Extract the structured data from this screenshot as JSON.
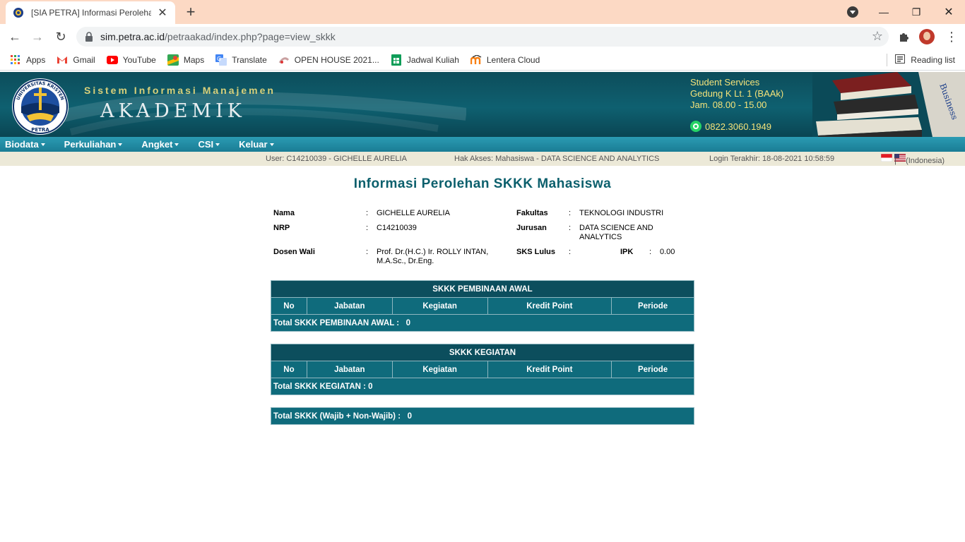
{
  "browser": {
    "tab_title": "[SIA PETRA] Informasi Perolehan",
    "url_host": "sim.petra.ac.id",
    "url_path": "/petraakad/index.php?page=view_skkk",
    "bookmarks": [
      "Apps",
      "Gmail",
      "YouTube",
      "Maps",
      "Translate",
      "OPEN HOUSE 2021...",
      "Jadwal Kuliah",
      "Lentera Cloud"
    ],
    "reading_list": "Reading list"
  },
  "header": {
    "logo_text_top": "UNIVERSITAS KRISTEN",
    "logo_text_bottom": "PETRA",
    "system_title": "Sistem Informasi Manajemen",
    "system_name": "AKADEMIK",
    "services_title": "Student Services",
    "services_location": "Gedung K Lt. 1 (BAAk)",
    "services_hours": "Jam. 08.00 - 15.00",
    "whatsapp": "0822.3060.1949",
    "book_spine": "Business"
  },
  "menu": [
    "Biodata",
    "Perkuliahan",
    "Angket",
    "CSI",
    "Keluar"
  ],
  "infobar": {
    "user": "User: C14210039 - GICHELLE AURELIA",
    "access": "Hak Akses: Mahasiswa - DATA SCIENCE AND ANALYTICS",
    "last_login": "Login Terakhir: 18-08-2021 10:58:59",
    "language": "(Indonesia)"
  },
  "page": {
    "title": "Informasi Perolehan SKKK Mahasiswa"
  },
  "student": {
    "nama_label": "Nama",
    "nama": "GICHELLE AURELIA",
    "nrp_label": "NRP",
    "nrp": "C14210039",
    "dosen_label": "Dosen Wali",
    "dosen_line1": "Prof. Dr.(H.C.) Ir. ROLLY INTAN,",
    "dosen_line2": "M.A.Sc., Dr.Eng.",
    "fakultas_label": "Fakultas",
    "fakultas": "TEKNOLOGI INDUSTRI",
    "jurusan_label": "Jurusan",
    "jurusan_line1": "DATA SCIENCE AND",
    "jurusan_line2": "ANALYTICS",
    "sks_label": "SKS Lulus",
    "sks": "",
    "ipk_label": "IPK",
    "ipk": "0.00",
    "colon": ":"
  },
  "tables": {
    "columns": [
      "No",
      "Jabatan",
      "Kegiatan",
      "Kredit Point",
      "Periode"
    ],
    "awal": {
      "title": "SKKK PEMBINAAN AWAL",
      "total": "Total SKKK PEMBINAAN AWAL :   0"
    },
    "kegiatan": {
      "title": "SKKK KEGIATAN",
      "total": "Total SKKK KEGIATAN : 0"
    },
    "grand_total": "Total SKKK (Wajib + Non-Wajib) :   0"
  }
}
